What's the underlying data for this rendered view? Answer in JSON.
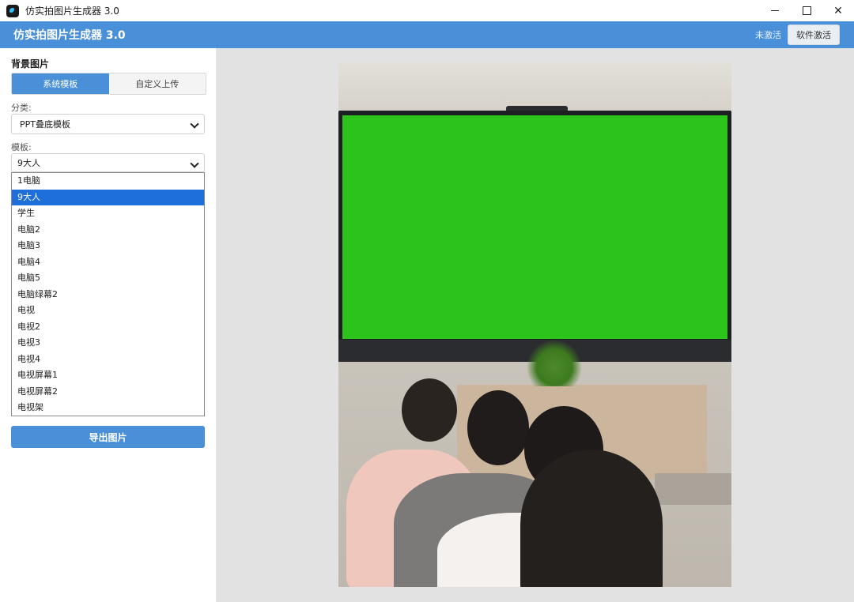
{
  "window": {
    "title": "仿实拍图片生成器 3.0",
    "controls": [
      "minimize",
      "maximize",
      "close"
    ]
  },
  "header": {
    "app_title": "仿实拍图片生成器 3.0",
    "status": "未激活",
    "activate_button": "软件激活",
    "accent_color": "#4a90d9"
  },
  "sidebar": {
    "background_label": "背景图片",
    "tabs": [
      {
        "label": "系统模板",
        "active": true
      },
      {
        "label": "自定义上传",
        "active": false
      }
    ],
    "category_label": "分类:",
    "category_value": "PPT叠底模板",
    "template_label": "模板:",
    "template_value": "9大人",
    "template_options": [
      "1电脑",
      "9大人",
      "学生",
      "电脑2",
      "电脑3",
      "电脑4",
      "电脑5",
      "电脑绿幕2",
      "电视",
      "电视2",
      "电视3",
      "电视4",
      "电视屏幕1",
      "电视屏幕2",
      "电视架"
    ],
    "selected_option_index": 1,
    "export_button": "导出图片"
  },
  "preview": {
    "image_description_icon": "classroom-photo",
    "screen_color": "#2cc31a"
  }
}
